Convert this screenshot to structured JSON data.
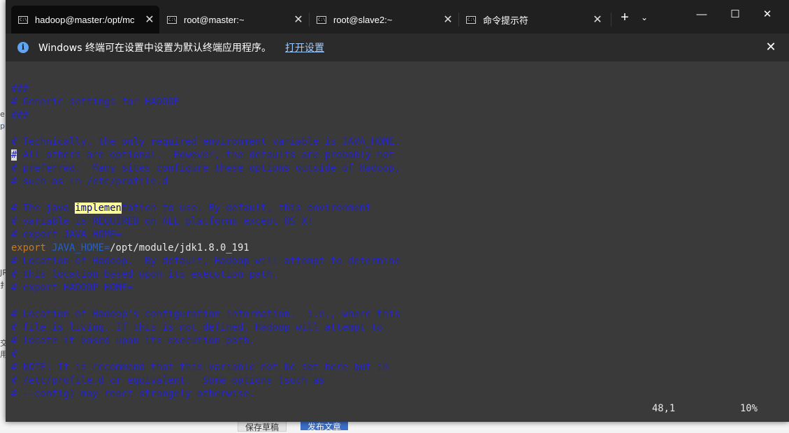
{
  "background_page": {
    "left_fragments": [
      "e",
      "p",
      "JR",
      "扌",
      "交",
      "用"
    ],
    "save_button": "保存草稿",
    "publish_button": "发布文章"
  },
  "tabs": [
    {
      "title": "hadoop@master:/opt/mc",
      "active": true
    },
    {
      "title": "root@master:~",
      "active": false
    },
    {
      "title": "root@slave2:~",
      "active": false
    },
    {
      "title": "命令提示符",
      "active": false
    }
  ],
  "tab_icon_text": "C:\\",
  "window_controls": {
    "new_tab": "+",
    "dropdown": "⌄",
    "minimize": "—",
    "maximize": "☐",
    "close": "✕"
  },
  "infobar": {
    "message": "Windows 终端可在设置中设置为默认终端应用程序。",
    "link": "打开设置",
    "close": "✕"
  },
  "editor": {
    "lines": [
      "###",
      "# Generic settings for HADOOP",
      "###",
      "",
      "# Technically, the only required environment variable is JAVA_HOME.",
      "# All others are optional.  However, the defaults are probably not",
      "# preferred.  Many sites configure these options outside of Hadoop,",
      "# such as in /etc/profile.d",
      "",
      "# The java implementation to use. By default, this environment",
      "# variable is REQUIRED on ALL platforms except OS X!",
      "# export JAVA_HOME=",
      "export JAVA_HOME=/opt/module/jdk1.8.0_191",
      "# Location of Hadoop.  By default, Hadoop will attempt to determine",
      "# this location based upon its execution path.",
      "# export HADOOP_HOME=",
      "",
      "# Location of Hadoop's configuration information.  i.e., where this",
      "# file is living. If this is not defined, Hadoop will attempt to",
      "# locate it based upon its execution path.",
      "#",
      "# NOTE: It is recommend that this variable not be set here but in",
      "# /etc/profile.d or equivalent.  Some options (such as",
      "# --config) may react strangely otherwise."
    ],
    "search_highlight": "implemen",
    "export_keyword": "export",
    "export_var": "JAVA_HOME=",
    "export_value": "/opt/module/jdk1.8.0_191",
    "status_position": "48,1",
    "status_percent": "10%"
  }
}
